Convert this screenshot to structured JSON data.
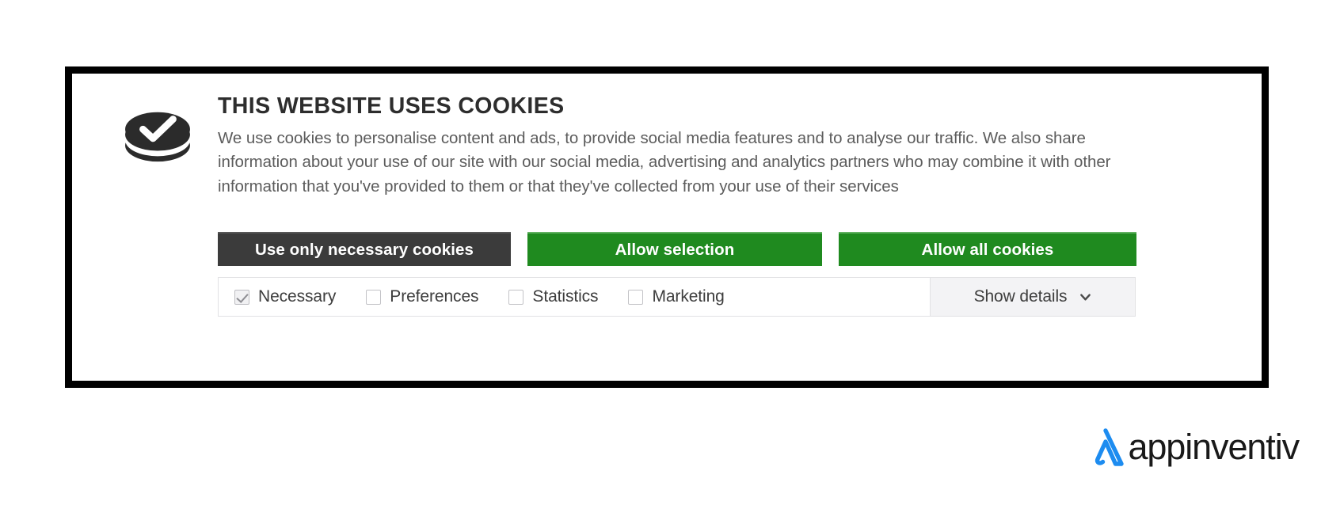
{
  "banner": {
    "icon_name": "cookie-check-icon",
    "headline": "THIS WEBSITE USES COOKIES",
    "body": "We use cookies to personalise content and ads, to provide social media features and to analyse our traffic. We also share information about your use of our site with our social media, advertising and analytics partners who may combine it with other information that you've provided to them or that they've collected from your use of their services",
    "buttons": [
      {
        "label": "Use only necessary cookies",
        "style": "dark",
        "color": "#3b3b3b"
      },
      {
        "label": "Allow selection",
        "style": "green",
        "color": "#1f8a1f"
      },
      {
        "label": "Allow all cookies",
        "style": "green",
        "color": "#1f8a1f"
      }
    ],
    "categories": [
      {
        "label": "Necessary",
        "checked": true
      },
      {
        "label": "Preferences",
        "checked": false
      },
      {
        "label": "Statistics",
        "checked": false
      },
      {
        "label": "Marketing",
        "checked": false
      }
    ],
    "show_details": {
      "label": "Show details",
      "icon_name": "chevron-down-icon"
    }
  },
  "watermark": {
    "mark_name": "appinventiv-logo-mark",
    "text": "appinventiv",
    "accent_color": "#1d8cf0"
  }
}
